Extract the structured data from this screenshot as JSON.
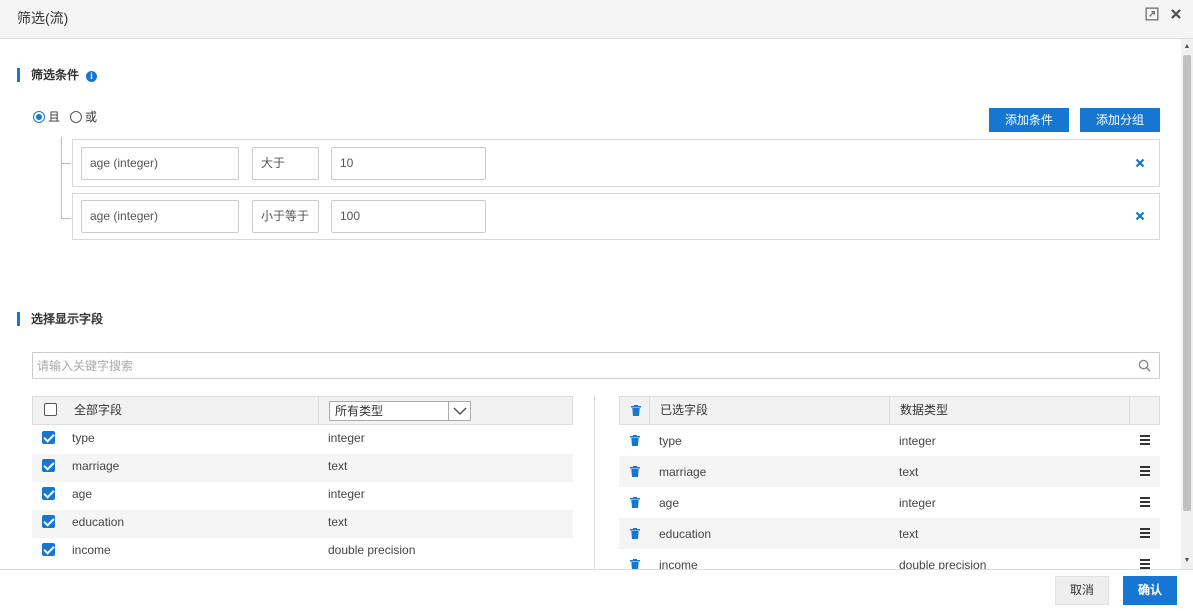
{
  "dialog": {
    "title": "筛选(流)",
    "expand_icon": "expand-icon",
    "close_icon": "close-icon"
  },
  "filter": {
    "section_title": "筛选条件",
    "info_icon": "info-icon",
    "logic": {
      "and_label": "且",
      "or_label": "或",
      "selected": "and"
    },
    "add_condition_label": "添加条件",
    "add_group_label": "添加分组",
    "conditions": [
      {
        "field": "age (integer)",
        "operator": "大于",
        "value": "10"
      },
      {
        "field": "age (integer)",
        "operator": "小于等于",
        "value": "100"
      }
    ],
    "delete_icon": "close-x-icon"
  },
  "fields": {
    "section_title": "选择显示字段",
    "search_placeholder": "请输入关键字搜索",
    "left": {
      "header_all": "全部字段",
      "type_filter_selected": "所有类型",
      "rows": [
        {
          "name": "type",
          "type": "integer",
          "checked": true
        },
        {
          "name": "marriage",
          "type": "text",
          "checked": true
        },
        {
          "name": "age",
          "type": "integer",
          "checked": true
        },
        {
          "name": "education",
          "type": "text",
          "checked": true
        },
        {
          "name": "income",
          "type": "double precision",
          "checked": true
        }
      ]
    },
    "right": {
      "header_selected": "已选字段",
      "header_type": "数据类型",
      "rows": [
        {
          "name": "type",
          "type": "integer"
        },
        {
          "name": "marriage",
          "type": "text"
        },
        {
          "name": "age",
          "type": "integer"
        },
        {
          "name": "education",
          "type": "text"
        },
        {
          "name": "income",
          "type": "double precision"
        }
      ]
    }
  },
  "footer": {
    "cancel_label": "取消",
    "confirm_label": "确认"
  },
  "colors": {
    "accent": "#1677d2"
  }
}
